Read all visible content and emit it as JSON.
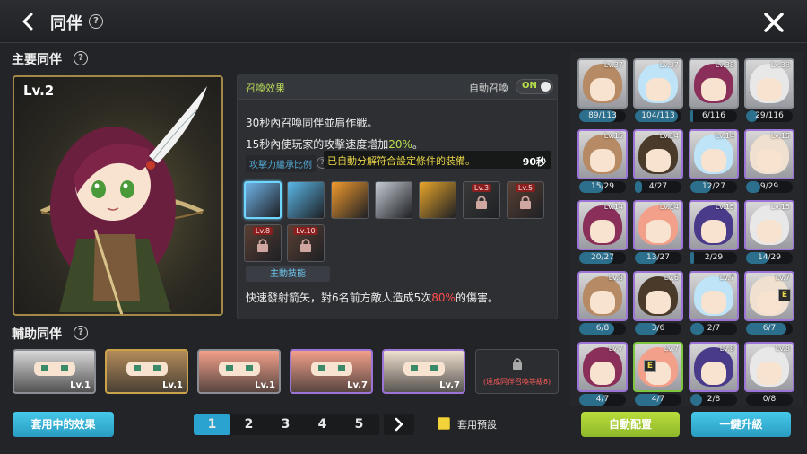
{
  "header": {
    "title": "同伴",
    "help": "?"
  },
  "main_section": {
    "label": "主要同伴",
    "help": "?"
  },
  "main_companion": {
    "level": "Lv.2"
  },
  "summon": {
    "title": "召喚效果",
    "auto_label": "自動召喚",
    "toggle": "ON",
    "line1": "30秒內召喚同伴並肩作戰。",
    "line2_pre": "15秒內使玩家的攻擊速度增加",
    "line2_value": "20%",
    "line2_post": "。",
    "inherit_label": "攻擊力繼承比例",
    "toast": "已自動分解符合設定條件的裝備。",
    "toast_time": "90秒"
  },
  "skills": [
    {
      "color": "#6fb4e8"
    },
    {
      "color": "#5ab8e8"
    },
    {
      "color": "#f29a2e"
    },
    {
      "color": "#c6ccd4"
    },
    {
      "color": "#e8a52a"
    },
    {
      "color": "#3a3a3a",
      "lv": "Lv.3",
      "locked": true
    },
    {
      "color": "#5a3f33",
      "lv": "Lv.5",
      "locked": true
    },
    {
      "color": "#5a3f33",
      "lv": "Lv.8",
      "locked": true
    },
    {
      "color": "#5a3f33",
      "lv": "Lv.10",
      "locked": true
    }
  ],
  "active_skill_label": "主動技能",
  "skill_desc": {
    "pre": "快速發射箭矢，對6名前方敵人造成5次",
    "value": "80%",
    "post": "的傷害。"
  },
  "support_section": {
    "label": "輔助同伴",
    "help": "?"
  },
  "support_slots": [
    {
      "level": "Lv.1",
      "border": "#8a8e94",
      "bg": "#d8d8d8"
    },
    {
      "level": "Lv.1",
      "border": "#c9a24a",
      "bg": "#b38b5a"
    },
    {
      "level": "Lv.1",
      "border": "#8a8e94",
      "bg": "#f2a08a"
    },
    {
      "level": "Lv.7",
      "border": "#9c73d6",
      "bg": "#f2a08a"
    },
    {
      "level": "Lv.7",
      "border": "#9c73d6",
      "bg": "#efe0cf"
    }
  ],
  "locked_slot": {
    "text": "(達成同伴召喚等級8)"
  },
  "bottom": {
    "effect_button": "套用中的效果",
    "pages": [
      "1",
      "2",
      "3",
      "4",
      "5"
    ],
    "active_page": "1",
    "preset_label": "套用預設",
    "auto_button": "自動配置",
    "upgrade_button": "一鍵升級"
  },
  "grid": [
    {
      "lv": "Lv.37",
      "count": "89/113",
      "fill": 0.79,
      "frame": "gray",
      "skin": "#b58a64"
    },
    {
      "lv": "Lv.37",
      "count": "104/113",
      "fill": 0.92,
      "frame": "gray",
      "skin": "#bfe3f7"
    },
    {
      "lv": "Lv.38",
      "count": "6/116",
      "fill": 0.05,
      "frame": "gray",
      "skin": "#8a2f5a"
    },
    {
      "lv": "Lv.38",
      "count": "29/116",
      "fill": 0.25,
      "frame": "gray",
      "skin": "#e8e8e8"
    },
    {
      "lv": "Lv.15",
      "count": "15/29",
      "fill": 0.52,
      "frame": "purple",
      "skin": "#b58a64"
    },
    {
      "lv": "Lv.14",
      "count": "4/27",
      "fill": 0.15,
      "frame": "purple",
      "skin": "#4a3a2a"
    },
    {
      "lv": "Lv.14",
      "count": "12/27",
      "fill": 0.44,
      "frame": "purple",
      "skin": "#bfe3f7"
    },
    {
      "lv": "Lv.15",
      "count": "9/29",
      "fill": 0.31,
      "frame": "purple",
      "skin": "#efe0cf"
    },
    {
      "lv": "Lv.14",
      "count": "20/27",
      "fill": 0.74,
      "frame": "purple",
      "skin": "#8a2f5a"
    },
    {
      "lv": "Lv.14",
      "count": "13/27",
      "fill": 0.48,
      "frame": "purple",
      "skin": "#f2a08a"
    },
    {
      "lv": "Lv.15",
      "count": "2/29",
      "fill": 0.07,
      "frame": "purple",
      "skin": "#4a3a8a"
    },
    {
      "lv": "Lv.15",
      "count": "14/29",
      "fill": 0.48,
      "frame": "purple",
      "skin": "#e8e8e8"
    },
    {
      "lv": "Lv.8",
      "count": "6/8",
      "fill": 0.75,
      "frame": "purple",
      "skin": "#b58a64"
    },
    {
      "lv": "Lv.6",
      "count": "3/6",
      "fill": 0.5,
      "frame": "purple",
      "skin": "#4a3a2a"
    },
    {
      "lv": "Lv.7",
      "count": "2/7",
      "fill": 0.29,
      "frame": "purple",
      "skin": "#bfe3f7"
    },
    {
      "lv": "Lv.7",
      "count": "6/7",
      "fill": 0.86,
      "frame": "purple",
      "skin": "#efe0cf",
      "badge": "E"
    },
    {
      "lv": "Lv.7",
      "count": "4/7",
      "fill": 0.57,
      "frame": "purple",
      "skin": "#8a2f5a"
    },
    {
      "lv": "Lv.7",
      "count": "4/7",
      "fill": 0.57,
      "frame": "green",
      "skin": "#f2a08a",
      "badge": "E"
    },
    {
      "lv": "Lv.8",
      "count": "2/8",
      "fill": 0.25,
      "frame": "purple",
      "skin": "#4a3a8a"
    },
    {
      "lv": "Lv.8",
      "count": "0/8",
      "fill": 0.0,
      "frame": "purple",
      "skin": "#e8e8e8"
    }
  ]
}
